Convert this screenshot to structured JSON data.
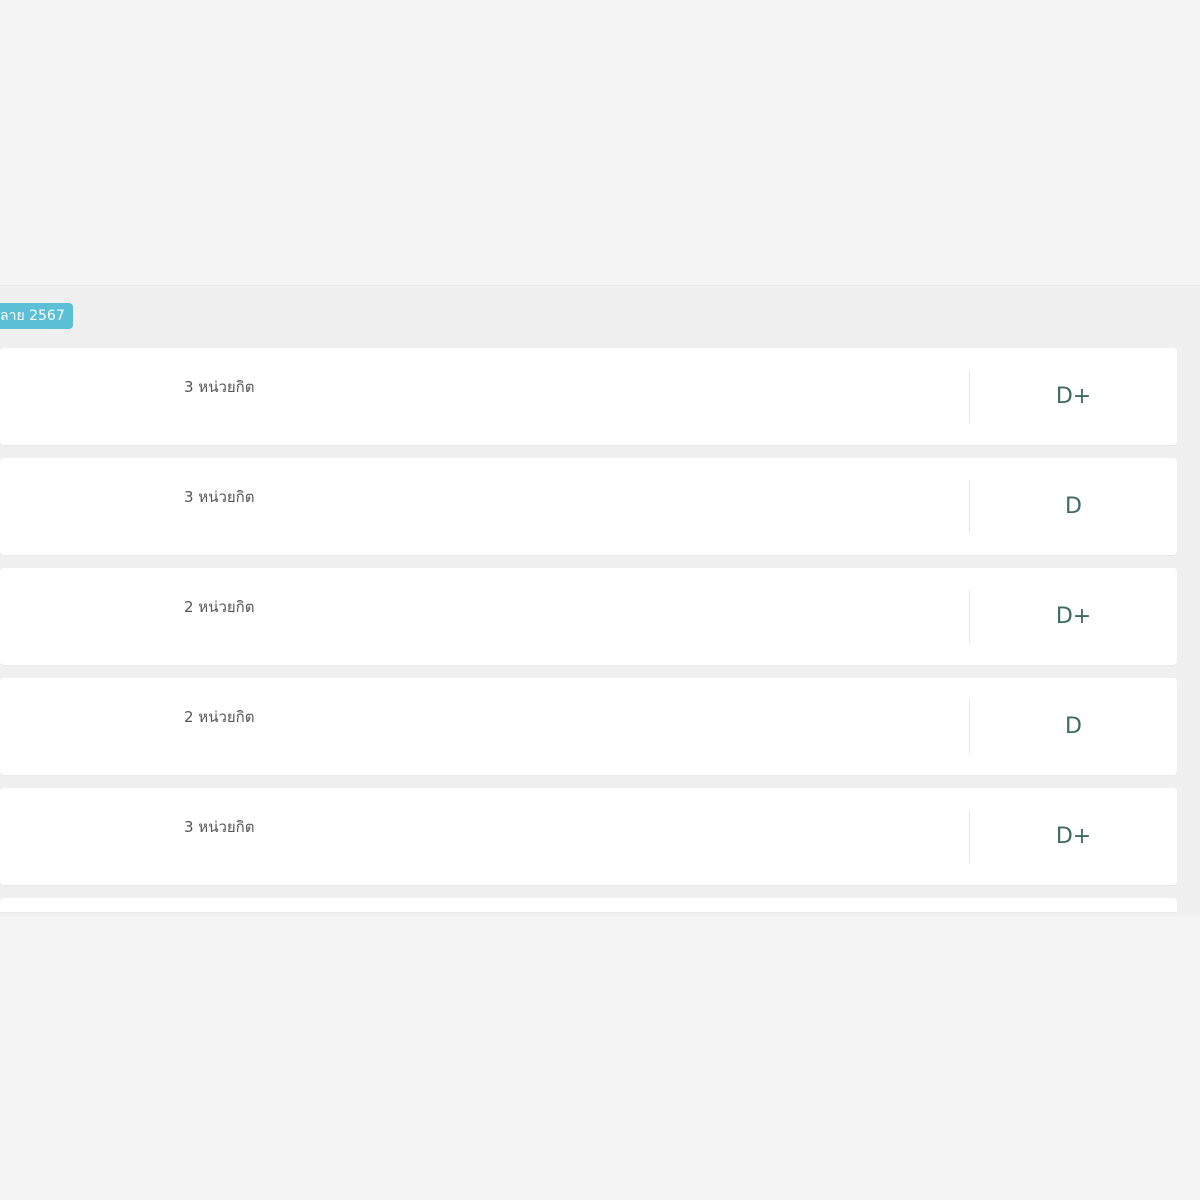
{
  "term": {
    "label": "ลาย 2567"
  },
  "courses": [
    {
      "credits": "3 หน่วยกิต",
      "grade": "D+"
    },
    {
      "credits": "3 หน่วยกิต",
      "grade": "D"
    },
    {
      "credits": "2 หน่วยกิต",
      "grade": "D+"
    },
    {
      "credits": "2 หน่วยกิต",
      "grade": "D"
    },
    {
      "credits": "3 หน่วยกิต",
      "grade": "D+"
    }
  ],
  "colors": {
    "badge": "#5bc0d6",
    "grade_text": "#3e6b61",
    "background": "#f4f4f4"
  }
}
